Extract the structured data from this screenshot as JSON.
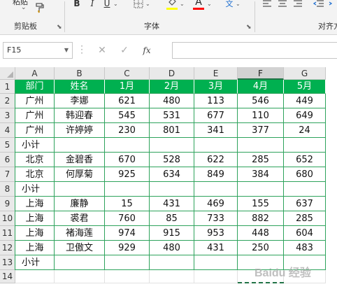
{
  "ribbon": {
    "clipboard_top_label": "粘贴",
    "clipboard_group": "剪贴板",
    "font_group": "字体",
    "align_group": "对齐方",
    "bold": "B",
    "italic": "I",
    "underline": "U",
    "font_color_letter": "A",
    "phonetic_char": "文",
    "highlight_color": "#ffff00",
    "font_color": "#ff0000"
  },
  "formula_bar": {
    "name_box": "F15",
    "cancel_symbol": "✕",
    "enter_symbol": "✓",
    "fx_label": "fx",
    "formula": ""
  },
  "columns": [
    "A",
    "B",
    "C",
    "D",
    "E",
    "F",
    "G"
  ],
  "selected_column": "F",
  "rows": [
    "1",
    "2",
    "3",
    "4",
    "5",
    "6",
    "7",
    "8",
    "9",
    "10",
    "11",
    "12",
    "13",
    "14"
  ],
  "table": [
    [
      "部门",
      "姓名",
      "1月",
      "2月",
      "3月",
      "4月",
      "5月"
    ],
    [
      "广州",
      "李娜",
      "621",
      "480",
      "113",
      "546",
      "449"
    ],
    [
      "广州",
      "韩迎春",
      "545",
      "531",
      "677",
      "110",
      "649"
    ],
    [
      "广州",
      "许婷婷",
      "230",
      "801",
      "341",
      "377",
      "24"
    ],
    [
      "小计",
      "",
      "",
      "",
      "",
      "",
      ""
    ],
    [
      "北京",
      "金碧香",
      "670",
      "528",
      "622",
      "285",
      "652"
    ],
    [
      "北京",
      "何厚菊",
      "925",
      "634",
      "849",
      "384",
      "680"
    ],
    [
      "小计",
      "",
      "",
      "",
      "",
      "",
      ""
    ],
    [
      "上海",
      "廉静",
      "15",
      "431",
      "469",
      "155",
      "637"
    ],
    [
      "上海",
      "裘君",
      "760",
      "85",
      "733",
      "882",
      "285"
    ],
    [
      "上海",
      "褚海莲",
      "974",
      "915",
      "953",
      "448",
      "604"
    ],
    [
      "上海",
      "卫傲文",
      "929",
      "480",
      "431",
      "250",
      "483"
    ],
    [
      "小计",
      "",
      "",
      "",
      "",
      "",
      ""
    ]
  ],
  "watermark": "Baidu 经验",
  "colors": {
    "header_fill": "#00b050",
    "header_text": "#ffffff",
    "border": "#2ea35c",
    "accent": "#217346"
  }
}
